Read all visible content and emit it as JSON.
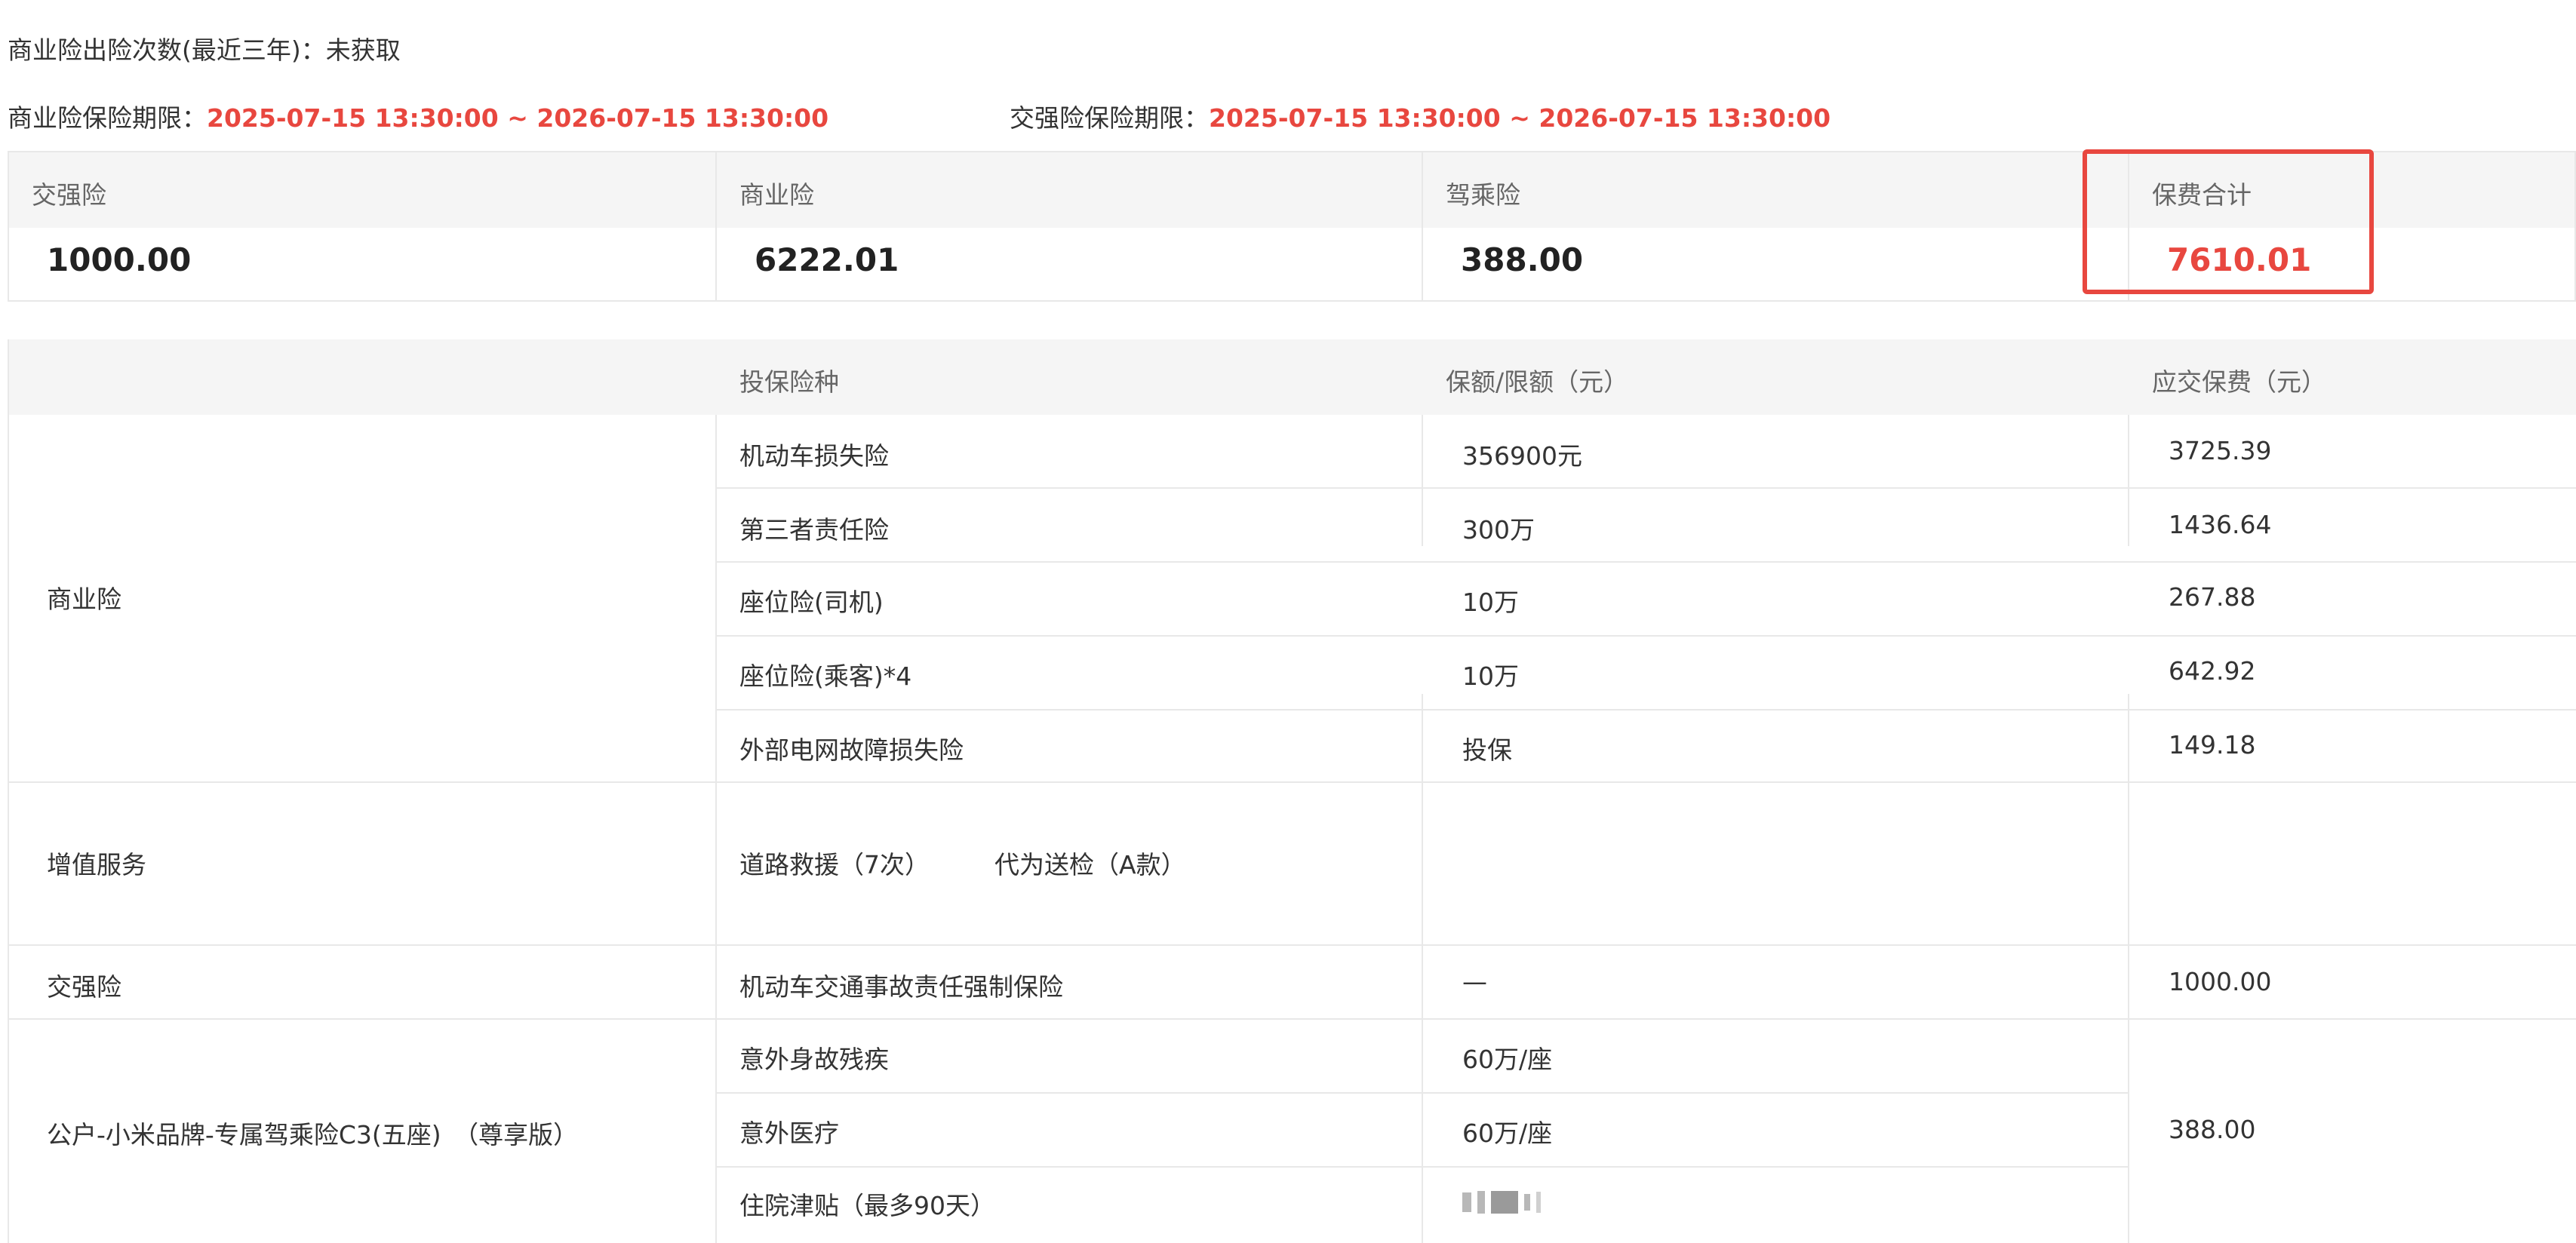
{
  "claims_line": "商业险出险次数(最近三年)：未获取",
  "commercial_period_label": "商业险保险期限：",
  "commercial_period_value": "2025-07-15 13:30:00 ~ 2026-07-15 13:30:00",
  "compulsory_period_label": "交强险保险期限：",
  "compulsory_period_value": "2025-07-15 13:30:00 ~ 2026-07-15 13:30:00",
  "summary": {
    "columns": [
      {
        "label": "交强险",
        "value": "1000.00"
      },
      {
        "label": "商业险",
        "value": "6222.01"
      },
      {
        "label": "驾乘险",
        "value": "388.00"
      },
      {
        "label": "保费合计",
        "value": "7610.01"
      }
    ]
  },
  "detail": {
    "headers": [
      "",
      "投保险种",
      "保额/限额（元）",
      "应交保费（元）"
    ],
    "commercial_group": "商业险",
    "commercial_rows": [
      {
        "type": "机动车损失险",
        "amount": "356900元",
        "premium": "3725.39"
      },
      {
        "type": "第三者责任险",
        "amount": "300万",
        "premium": "1436.64"
      },
      {
        "type": "座位险(司机)",
        "amount": "10万",
        "premium": "267.88"
      },
      {
        "type": "座位险(乘客)*4",
        "amount": "10万",
        "premium": "642.92"
      },
      {
        "type": "外部电网故障损失险",
        "amount": "投保",
        "premium": "149.18"
      }
    ],
    "value_added_label": "增值服务",
    "value_added_items": [
      "道路救援（7次）",
      "代为送检（A款）"
    ],
    "compulsory_group": "交强险",
    "compulsory_row": {
      "type": "机动车交通事故责任强制保险",
      "amount": "—",
      "premium": "1000.00"
    },
    "driver_group": "公户-小米品牌-专属驾乘险C3(五座)　（尊享版）",
    "driver_rows": [
      {
        "type": "意外身故残疾",
        "amount": "60万/座"
      },
      {
        "type": "意外医疗",
        "amount": "60万/座"
      },
      {
        "type": "住院津贴（最多90天）",
        "amount": ""
      }
    ],
    "driver_premium": "388.00"
  },
  "colors": {
    "accent_red": "#e8473f",
    "header_bg": "#f5f5f5",
    "border": "#e8e8e8"
  }
}
